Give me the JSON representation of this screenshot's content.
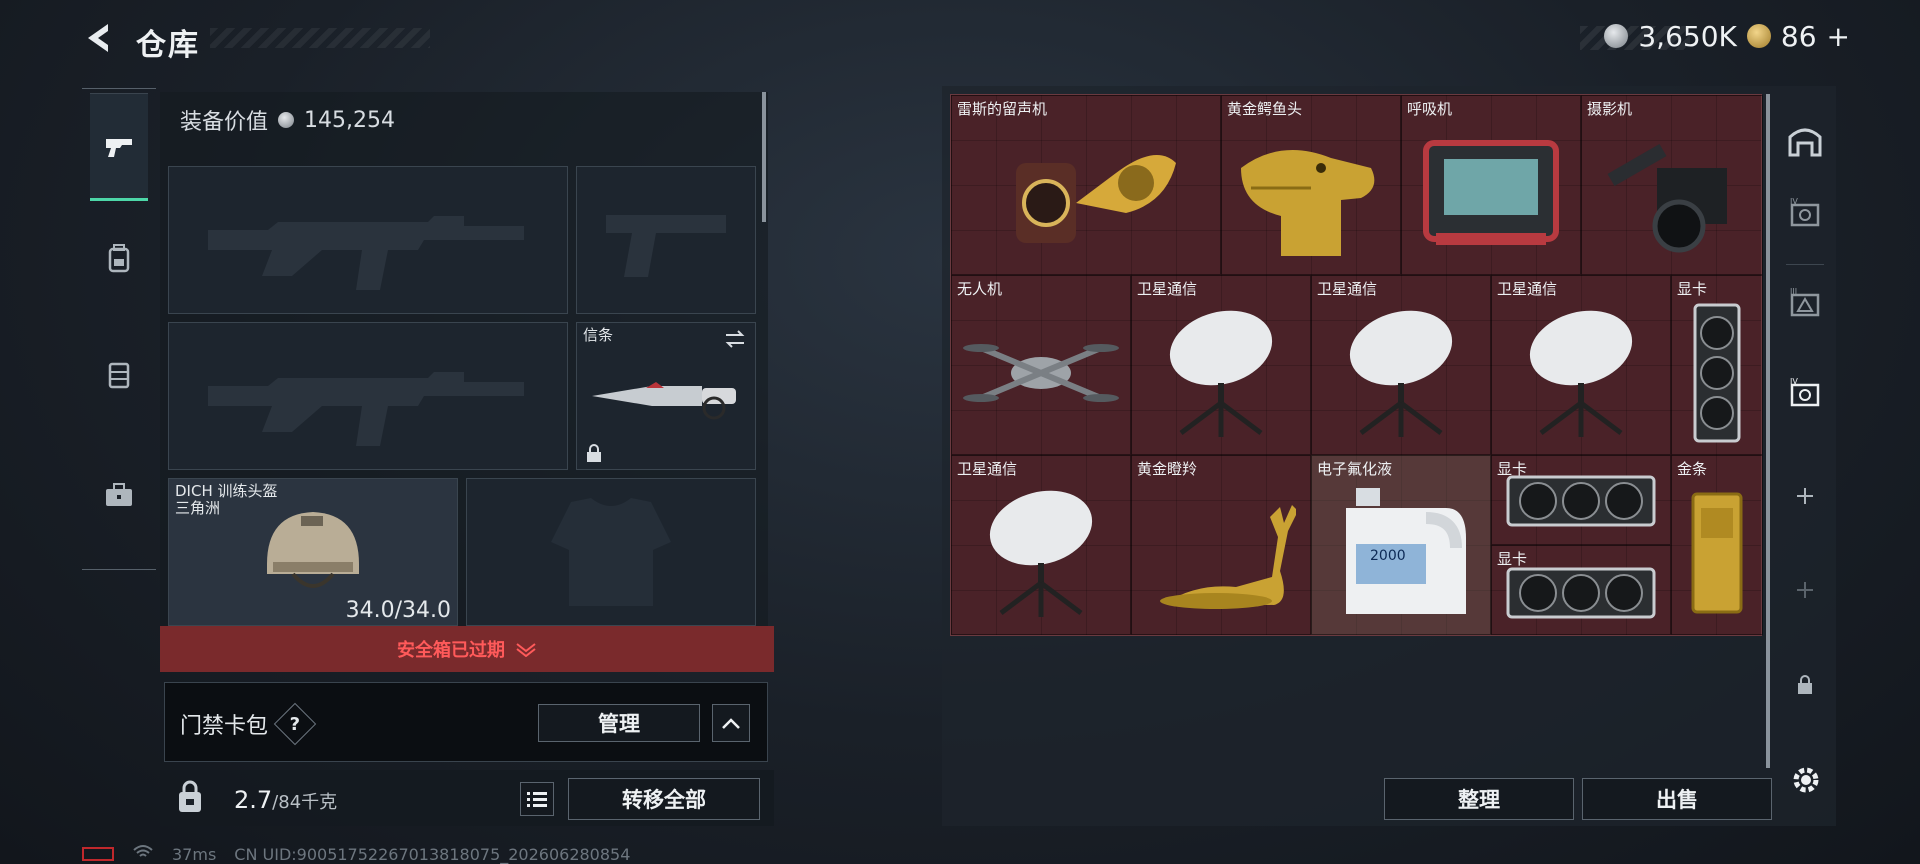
{
  "header": {
    "title": "仓库",
    "currency_value": "3,650K",
    "medal_value": "86",
    "medal_suffix": "+"
  },
  "loadout": {
    "equip_value_label": "装备价值",
    "equip_value": "145,254",
    "slots": {
      "melee_label": "信条",
      "helmet_label_line1": "DICH 训练头盔",
      "helmet_label_line2": "三角洲",
      "helmet_durability": "34.0/34.0"
    },
    "safe_banner": "安全箱已过期",
    "cardbox_label": "门禁卡包",
    "cardbox_help": "?",
    "manage_label": "管理",
    "weight_current": "2.7",
    "weight_max": "/84千克",
    "transfer_all_label": "转移全部"
  },
  "status": {
    "ping": "37ms",
    "uid": "CN UID:9005175226701381​8075_202606280854"
  },
  "storage": {
    "items": [
      {
        "name": "雷斯的留声机",
        "icon": "phonograph-icon"
      },
      {
        "name": "黄金鳄鱼头",
        "icon": "golden-crocodile-head-icon"
      },
      {
        "name": "呼吸机",
        "icon": "ventilator-icon"
      },
      {
        "name": "摄影机",
        "icon": "camera-icon"
      },
      {
        "name": "无人机",
        "icon": "drone-icon"
      },
      {
        "name": "卫星通信",
        "icon": "satellite-dish-icon"
      },
      {
        "name": "卫星通信",
        "icon": "satellite-dish-icon"
      },
      {
        "name": "卫星通信",
        "icon": "satellite-dish-icon"
      },
      {
        "name": "显卡",
        "icon": "graphics-card-icon"
      },
      {
        "name": "卫星通信",
        "icon": "satellite-dish-icon"
      },
      {
        "name": "黄金瞪羚",
        "icon": "golden-gazelle-icon"
      },
      {
        "name": "电子氟化液",
        "icon": "fluoride-jug-icon"
      },
      {
        "name": "显卡",
        "icon": "graphics-card-icon"
      },
      {
        "name": "显卡",
        "icon": "graphics-card-icon"
      },
      {
        "name": "金条",
        "icon": "gold-bar-icon"
      }
    ],
    "jug_label": "2000",
    "sort_label": "整理",
    "sell_label": "出售"
  },
  "colors": {
    "accent": "#4dd7a8",
    "grid_bg": "#4a2228",
    "banner_bg": "#7a2a2c",
    "banner_text": "#ff5a5a"
  }
}
